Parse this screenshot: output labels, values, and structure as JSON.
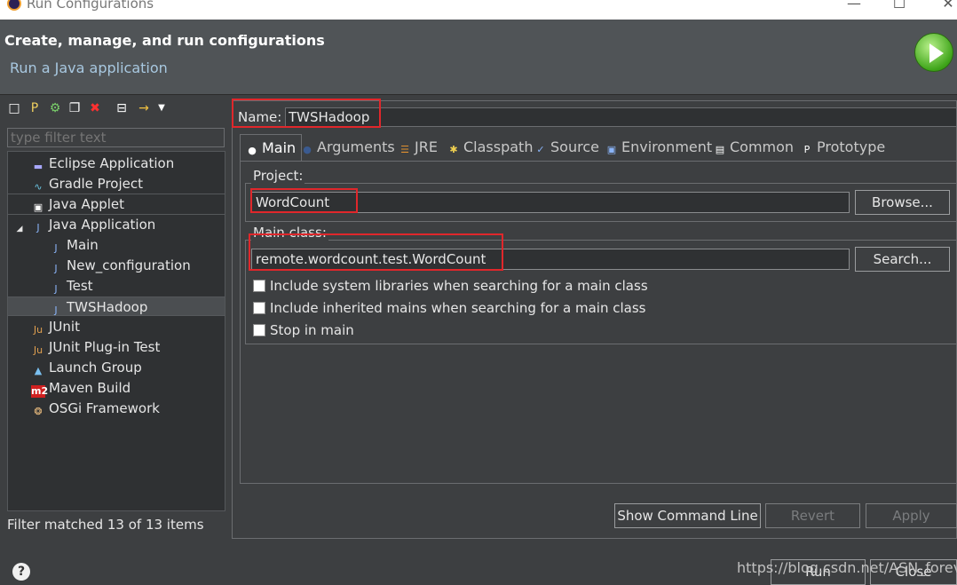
{
  "window": {
    "title": "Run Configurations",
    "controls": [
      "—",
      "☐",
      "✕"
    ]
  },
  "header": {
    "title": "Create, manage, and run configurations",
    "subtitle": "Run a Java application",
    "icon": "run-icon"
  },
  "left_panel": {
    "toolbar_icons": [
      "new-config-icon",
      "new-prototype-icon",
      "export-icon",
      "duplicate-icon",
      "delete-icon",
      "collapse-all-icon",
      "filter-icon",
      "dropdown-arrow-icon"
    ],
    "filter_placeholder": "type filter text",
    "tree": [
      {
        "label": "Eclipse Application",
        "icon": "eclipse-icon",
        "level": 0
      },
      {
        "label": "Gradle Project",
        "icon": "gradle-icon",
        "level": 0
      },
      {
        "label": "Java Applet",
        "icon": "applet-icon",
        "level": 0
      },
      {
        "label": "Java Application",
        "icon": "java-app-icon",
        "level": 0,
        "expanded": true
      },
      {
        "label": "Main",
        "icon": "java-app-icon",
        "level": 1
      },
      {
        "label": "New_configuration",
        "icon": "java-app-icon",
        "level": 1
      },
      {
        "label": "Test",
        "icon": "java-app-icon",
        "level": 1
      },
      {
        "label": "TWSHadoop",
        "icon": "java-app-icon",
        "level": 1,
        "selected": true
      },
      {
        "label": "JUnit",
        "icon": "junit-icon",
        "level": 0
      },
      {
        "label": "JUnit Plug-in Test",
        "icon": "junit-plugin-icon",
        "level": 0
      },
      {
        "label": "Launch Group",
        "icon": "launch-group-icon",
        "level": 0
      },
      {
        "label": "Maven Build",
        "icon": "maven-icon",
        "level": 0
      },
      {
        "label": "OSGi Framework",
        "icon": "osgi-icon",
        "level": 0
      }
    ],
    "status": "Filter matched 13 of 13 items"
  },
  "right_panel": {
    "name_label": "Name:",
    "name_value": "TWSHadoop",
    "tabs": [
      {
        "label": "Main",
        "icon": "main-tab-icon",
        "active": true
      },
      {
        "label": "Arguments",
        "icon": "arguments-tab-icon"
      },
      {
        "label": "JRE",
        "icon": "jre-tab-icon"
      },
      {
        "label": "Classpath",
        "icon": "classpath-tab-icon"
      },
      {
        "label": "Source",
        "icon": "source-tab-icon"
      },
      {
        "label": "Environment",
        "icon": "environment-tab-icon"
      },
      {
        "label": "Common",
        "icon": "common-tab-icon"
      },
      {
        "label": "Prototype",
        "icon": "prototype-tab-icon"
      }
    ],
    "project": {
      "label": "Project:",
      "value": "WordCount",
      "button": "Browse..."
    },
    "main_class": {
      "label": "Main class:",
      "value": "remote.wordcount.test.WordCount",
      "button": "Search..."
    },
    "checkboxes": [
      {
        "label": "Include system libraries when searching for a main class",
        "checked": false
      },
      {
        "label": "Include inherited mains when searching for a main class",
        "checked": false
      },
      {
        "label": "Stop in main",
        "checked": false
      }
    ],
    "buttons": {
      "show_command_line": "Show Command Line",
      "revert": "Revert",
      "apply": "Apply"
    }
  },
  "footer": {
    "run": "Run",
    "close": "Close",
    "watermark": "https://blog.csdn.net/ASN_forever"
  },
  "colors": {
    "highlight_box": "#e0272b",
    "background": "#3d3f41",
    "header": "#505457"
  }
}
